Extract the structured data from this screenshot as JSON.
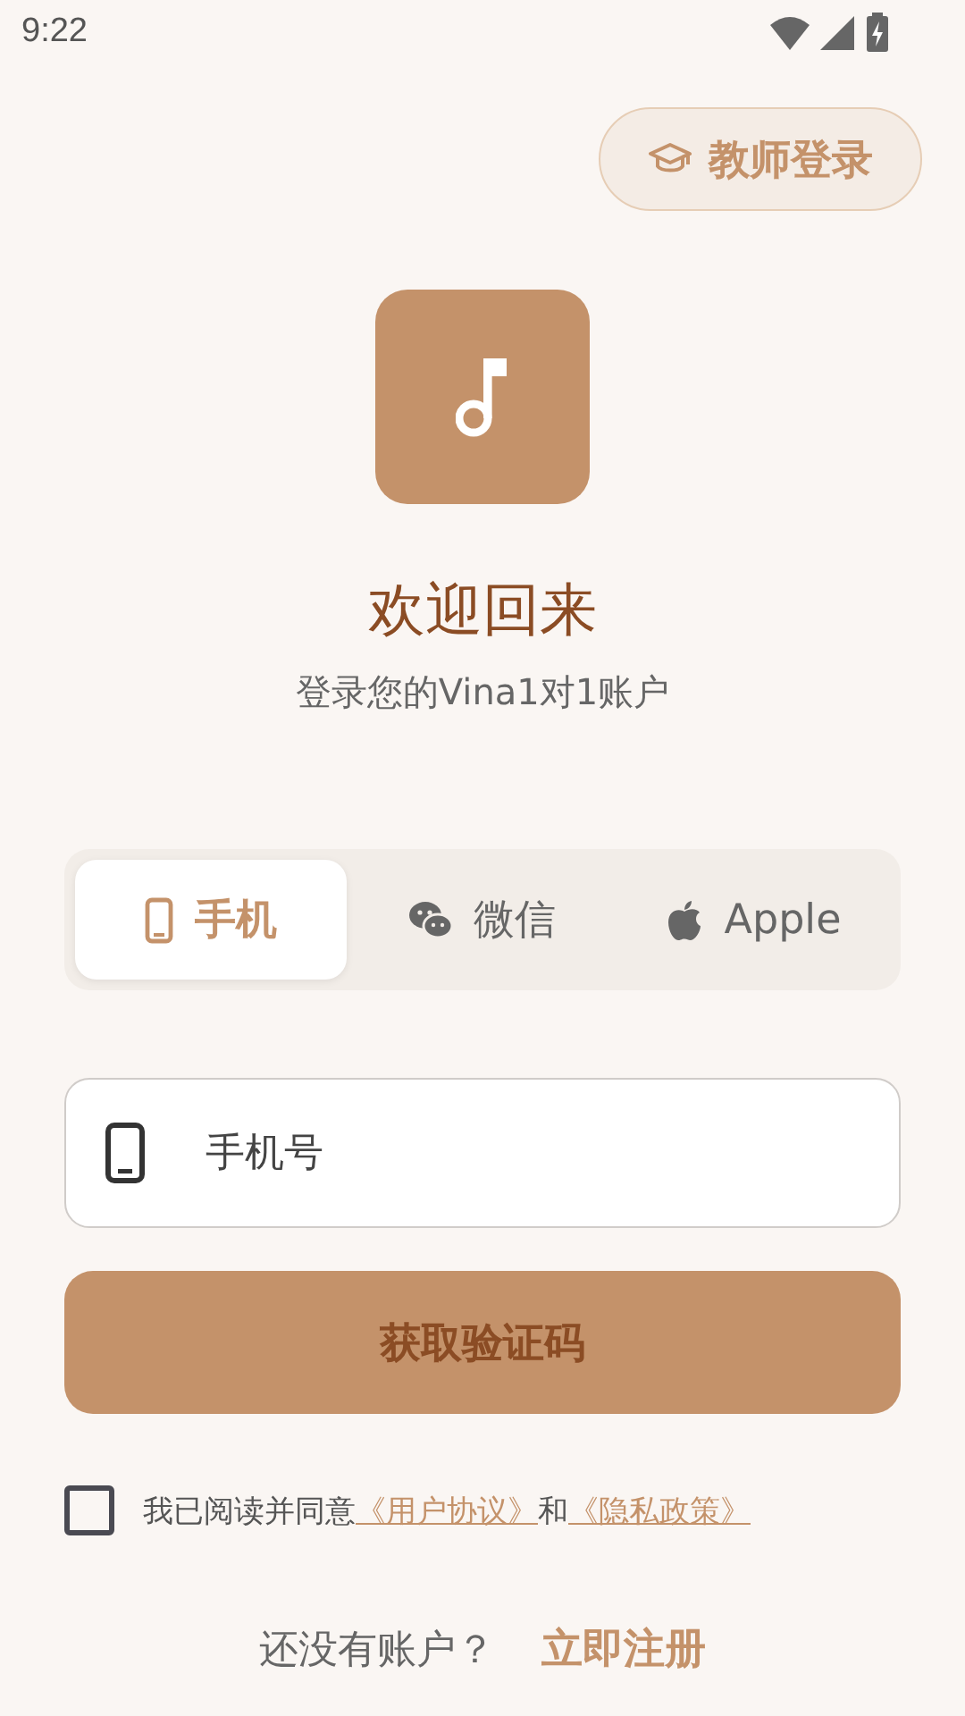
{
  "status_bar": {
    "time": "9:22"
  },
  "teacher_login": {
    "label": "教师登录"
  },
  "header": {
    "title": "欢迎回来",
    "subtitle": "登录您的Vina1对1账户"
  },
  "tabs": [
    {
      "label": "手机",
      "kind": "phone",
      "selected": true
    },
    {
      "label": "微信",
      "kind": "wechat",
      "selected": false
    },
    {
      "label": "Apple",
      "kind": "apple",
      "selected": false
    }
  ],
  "phone_field": {
    "placeholder": "手机号"
  },
  "submit": {
    "label": "获取验证码"
  },
  "agreement": {
    "checked": false,
    "text": "我已阅读并同意",
    "link_1": "《用户协议》",
    "joiner": "和",
    "link_2": "《隐私政策》"
  },
  "register": {
    "prompt": "还没有账户？",
    "link": "立即注册"
  }
}
